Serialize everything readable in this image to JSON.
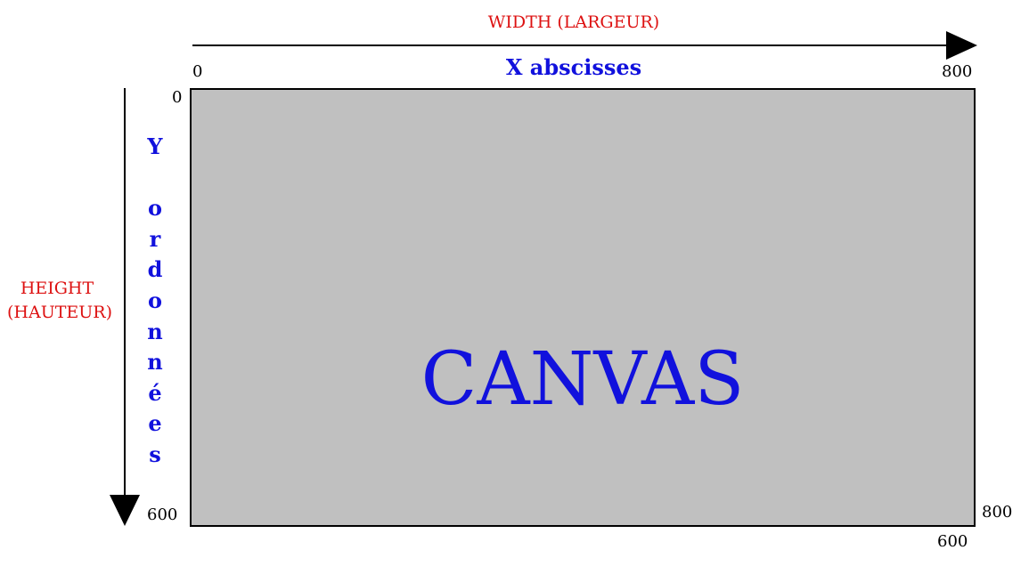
{
  "axes": {
    "width_label": "WIDTH (LARGEUR)",
    "height_label": "HEIGHT (HAUTEUR)",
    "x_title": "X abscisses",
    "y_title_letters": [
      "Y",
      "",
      "o",
      "r",
      "d",
      "o",
      "n",
      "n",
      "é",
      "e",
      "s"
    ]
  },
  "ticks": {
    "x_start": "0",
    "x_end": "800",
    "y_start": "0",
    "y_end": "600",
    "corner_x": "800",
    "corner_y": "600"
  },
  "canvas": {
    "label": "CANVAS",
    "fill_color": "#c0c0c0",
    "text_color": "#1111dd"
  },
  "colors": {
    "dimension_label": "#dd1111",
    "axis_title": "#1111dd",
    "arrow": "#000000"
  }
}
